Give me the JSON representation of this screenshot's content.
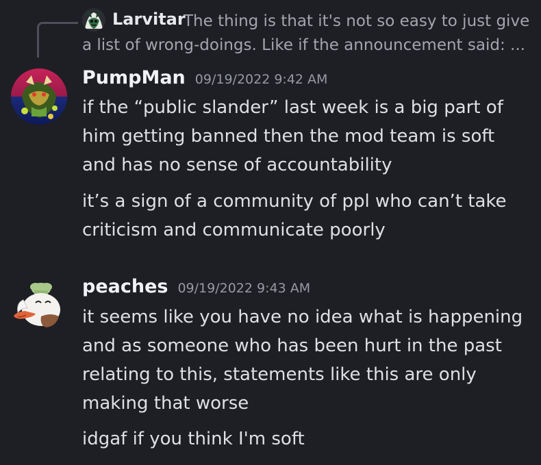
{
  "reply": {
    "author": "Larvitar",
    "text_line1": "The thing is that it's not so easy to just give",
    "text_line2": "a list of wrong-doings. Like if the announcement said: ..."
  },
  "messages": [
    {
      "author": "PumpMan",
      "timestamp": "09/19/2022 9:42 AM",
      "body": [
        [
          "if the “public slander” last week is a big part of",
          "him getting banned then the mod team is soft",
          "and has no sense of accountability"
        ],
        [
          "it’s a sign of a community of ppl who can’t take",
          "criticism and communicate poorly"
        ]
      ]
    },
    {
      "author": "peaches",
      "timestamp": "09/19/2022 9:43 AM",
      "body": [
        [
          "it seems like you have no idea what is happening",
          "and as someone who has been hurt in the past",
          "relating to this, statements like this are only",
          "making that worse"
        ],
        [
          "idgaf if you think I'm soft"
        ]
      ]
    }
  ]
}
